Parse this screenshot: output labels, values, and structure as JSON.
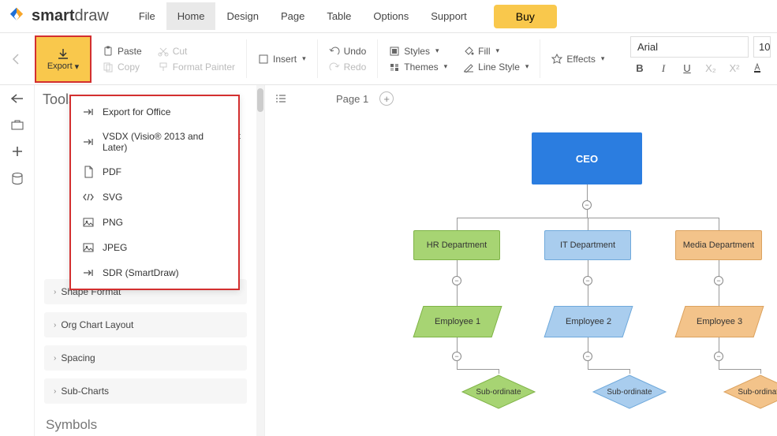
{
  "brand": {
    "name_bold": "smart",
    "name_light": "draw"
  },
  "menu": [
    "File",
    "Home",
    "Design",
    "Page",
    "Table",
    "Options",
    "Support"
  ],
  "active_menu": "Home",
  "buy_label": "Buy",
  "ribbon": {
    "export": "Export",
    "paste": "Paste",
    "copy": "Copy",
    "cut": "Cut",
    "format_painter": "Format Painter",
    "insert": "Insert",
    "undo": "Undo",
    "redo": "Redo",
    "styles": "Styles",
    "themes": "Themes",
    "fill": "Fill",
    "line_style": "Line Style",
    "effects": "Effects",
    "font_name": "Arial",
    "font_size": "10"
  },
  "export_menu": [
    {
      "icon": "office",
      "label": "Export for Office"
    },
    {
      "icon": "vsdx",
      "label": "VSDX (Visio® 2013 and Later)"
    },
    {
      "icon": "pdf",
      "label": "PDF"
    },
    {
      "icon": "svg",
      "label": "SVG"
    },
    {
      "icon": "png",
      "label": "PNG"
    },
    {
      "icon": "jpeg",
      "label": "JPEG"
    },
    {
      "icon": "sdr",
      "label": "SDR (SmartDraw)"
    }
  ],
  "left_panel": {
    "title": "Tools",
    "text_tool": "Text",
    "accordions": [
      "Shape Format",
      "Org Chart Layout",
      "Spacing",
      "Sub-Charts"
    ],
    "symbols_title": "Symbols"
  },
  "canvas": {
    "page_label": "Page 1"
  },
  "chart_data": {
    "type": "tree",
    "root": {
      "label": "CEO",
      "color": "#2b7de0"
    },
    "departments": [
      {
        "label": "HR Department",
        "color": "#a7d473",
        "employee": "Employee 1",
        "subordinate": "Sub-ordinate"
      },
      {
        "label": "IT Department",
        "color": "#a9cdee",
        "employee": "Employee 2",
        "subordinate": "Sub-ordinate"
      },
      {
        "label": "Media Department",
        "color": "#f3c38a",
        "employee": "Employee 3",
        "subordinate": "Sub-ordinate"
      }
    ]
  }
}
